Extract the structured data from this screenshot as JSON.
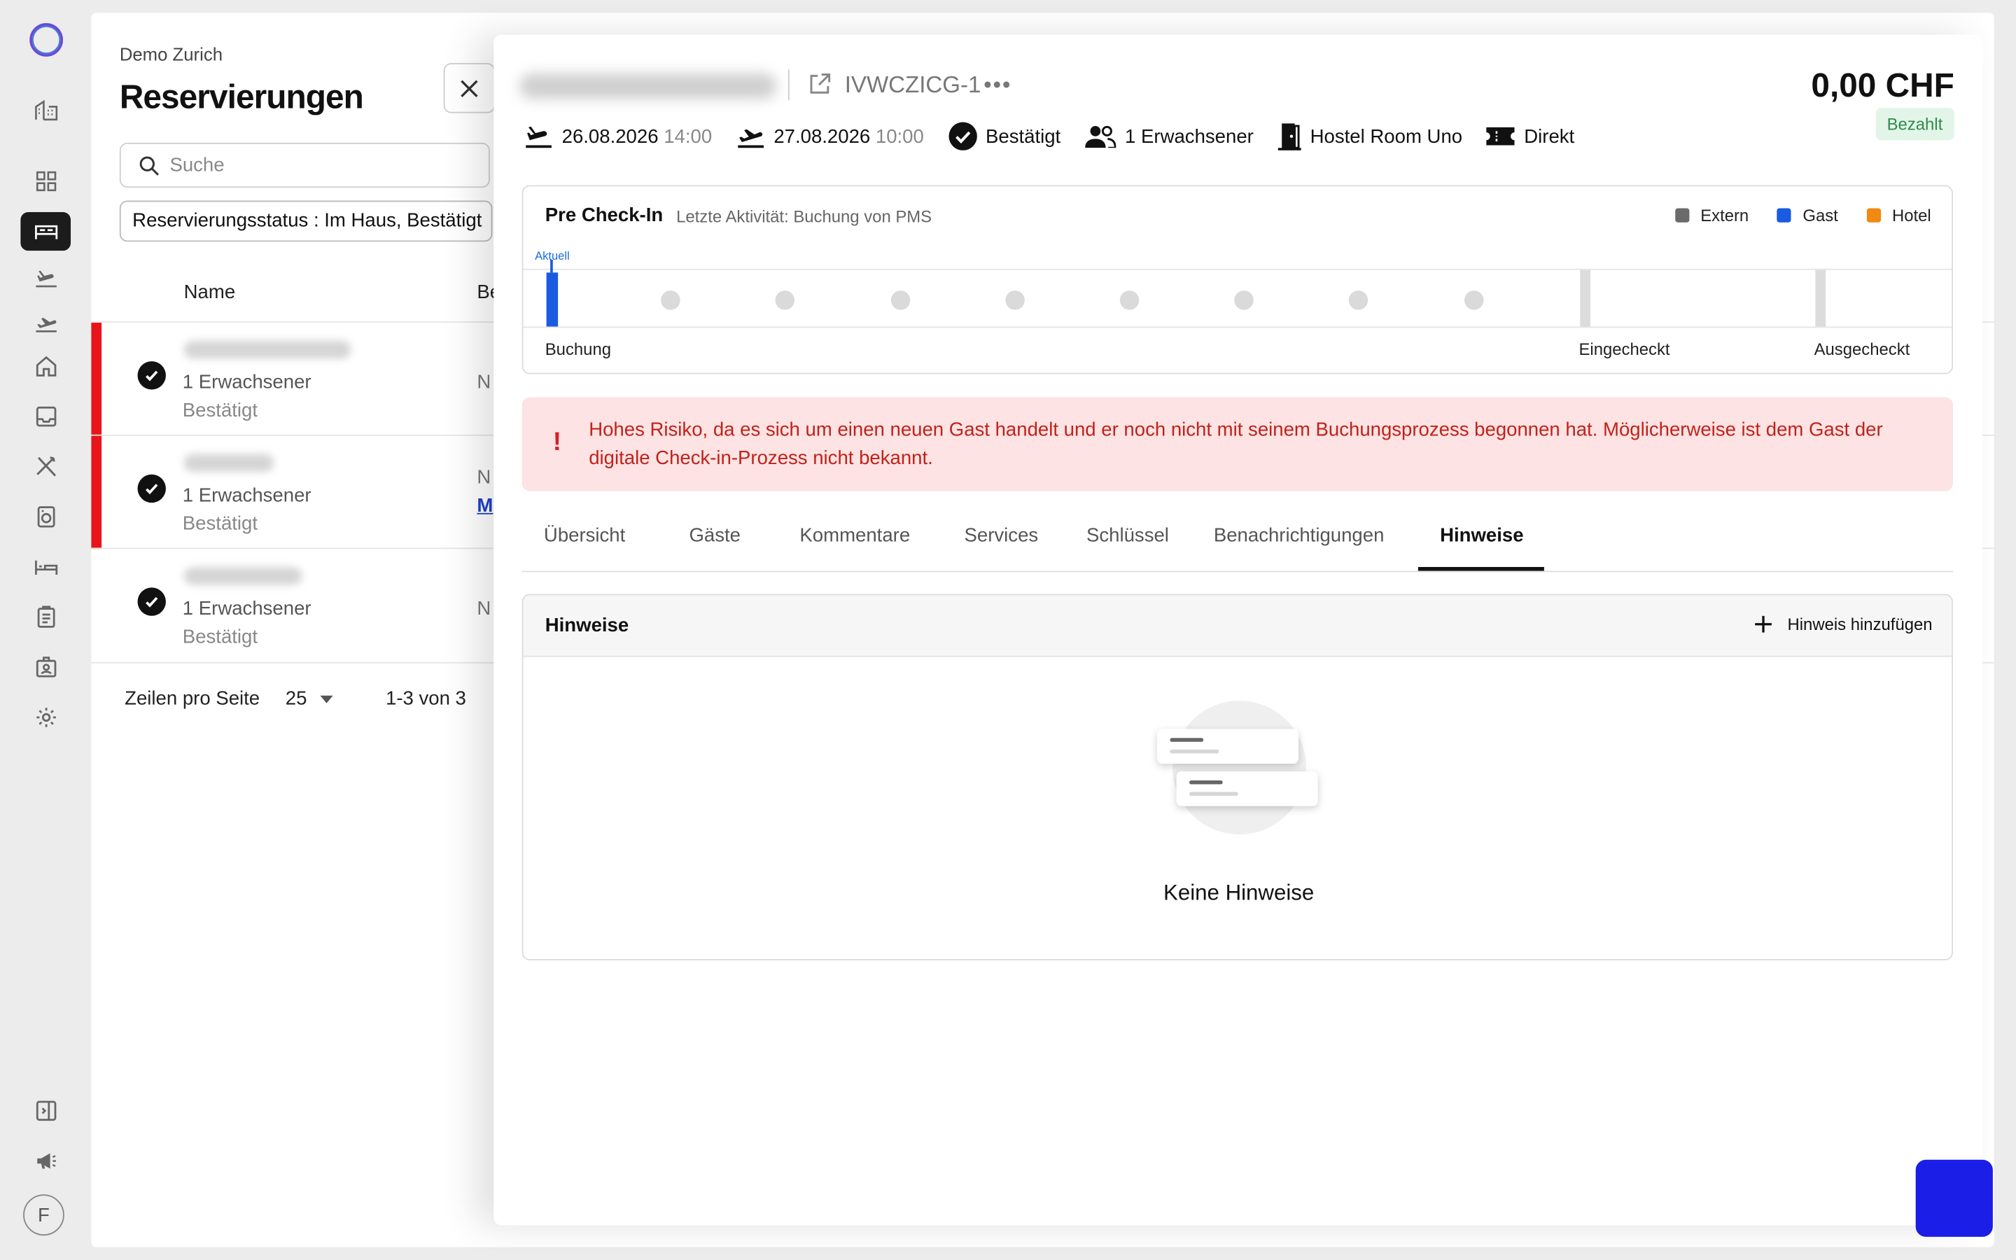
{
  "sidebar": {
    "icons": [
      "dashboard-icon",
      "grid-icon",
      "bed-icon",
      "arrival-icon",
      "departure-icon",
      "home-icon",
      "inbox-icon",
      "restaurant-icon",
      "laundry-icon",
      "room-icon",
      "clipboard-icon",
      "contacts-icon",
      "settings-icon"
    ],
    "bottom_icons": [
      "collapse-icon",
      "announcement-icon"
    ],
    "avatar_initial": "F"
  },
  "list": {
    "hotel_name": "Demo Zurich",
    "title": "Reservierungen",
    "search_placeholder": "Suche",
    "filter_chip": "Reservierungsstatus : Im Haus, Bestätigt",
    "columns": {
      "name": "Name",
      "cut": "Be"
    },
    "rows": [
      {
        "guests": "1 Erwachsener",
        "status": "Bestätigt",
        "cut": "N"
      },
      {
        "guests": "1 Erwachsener",
        "status": "Bestätigt",
        "cut": "N",
        "cut_link": "M"
      },
      {
        "guests": "1 Erwachsener",
        "status": "Bestätigt",
        "cut": "N"
      }
    ],
    "pager": {
      "rows_per_page_label": "Zeilen pro Seite",
      "rows_per_page_value": "25",
      "range": "1-3 von 3"
    }
  },
  "detail": {
    "reservation_code": "IVWCZICG-1",
    "price": "0,00 CHF",
    "payment_badge": "Bezahlt",
    "arrival_date": "26.08.2026",
    "arrival_time": "14:00",
    "departure_date": "27.08.2026",
    "departure_time": "10:00",
    "status": "Bestätigt",
    "occupancy": "1 Erwachsener",
    "room": "Hostel Room Uno",
    "channel": "Direkt",
    "precheckin": {
      "title": "Pre Check-In",
      "last_activity": "Letzte Aktivität: Buchung von PMS",
      "legend": [
        {
          "label": "Extern",
          "color": "#6b6b6b"
        },
        {
          "label": "Gast",
          "color": "#1a5be0"
        },
        {
          "label": "Hotel",
          "color": "#f08a12"
        }
      ],
      "now_label": "Aktuell",
      "steps": {
        "booking": "Buchung",
        "checked_in": "Eingecheckt",
        "checked_out": "Ausgecheckt"
      }
    },
    "alert": "Hohes Risiko, da es sich um einen neuen Gast handelt und er noch nicht mit seinem Buchungsprozess begonnen hat. Möglicherweise ist dem Gast der digitale Check-in-Prozess nicht bekannt.",
    "tabs": [
      "Übersicht",
      "Gäste",
      "Kommentare",
      "Services",
      "Schlüssel",
      "Benachrichtigungen",
      "Hinweise"
    ],
    "active_tab": "Hinweise",
    "notes": {
      "title": "Hinweise",
      "add_label": "Hinweis hinzufügen",
      "empty_text": "Keine Hinweise"
    }
  }
}
